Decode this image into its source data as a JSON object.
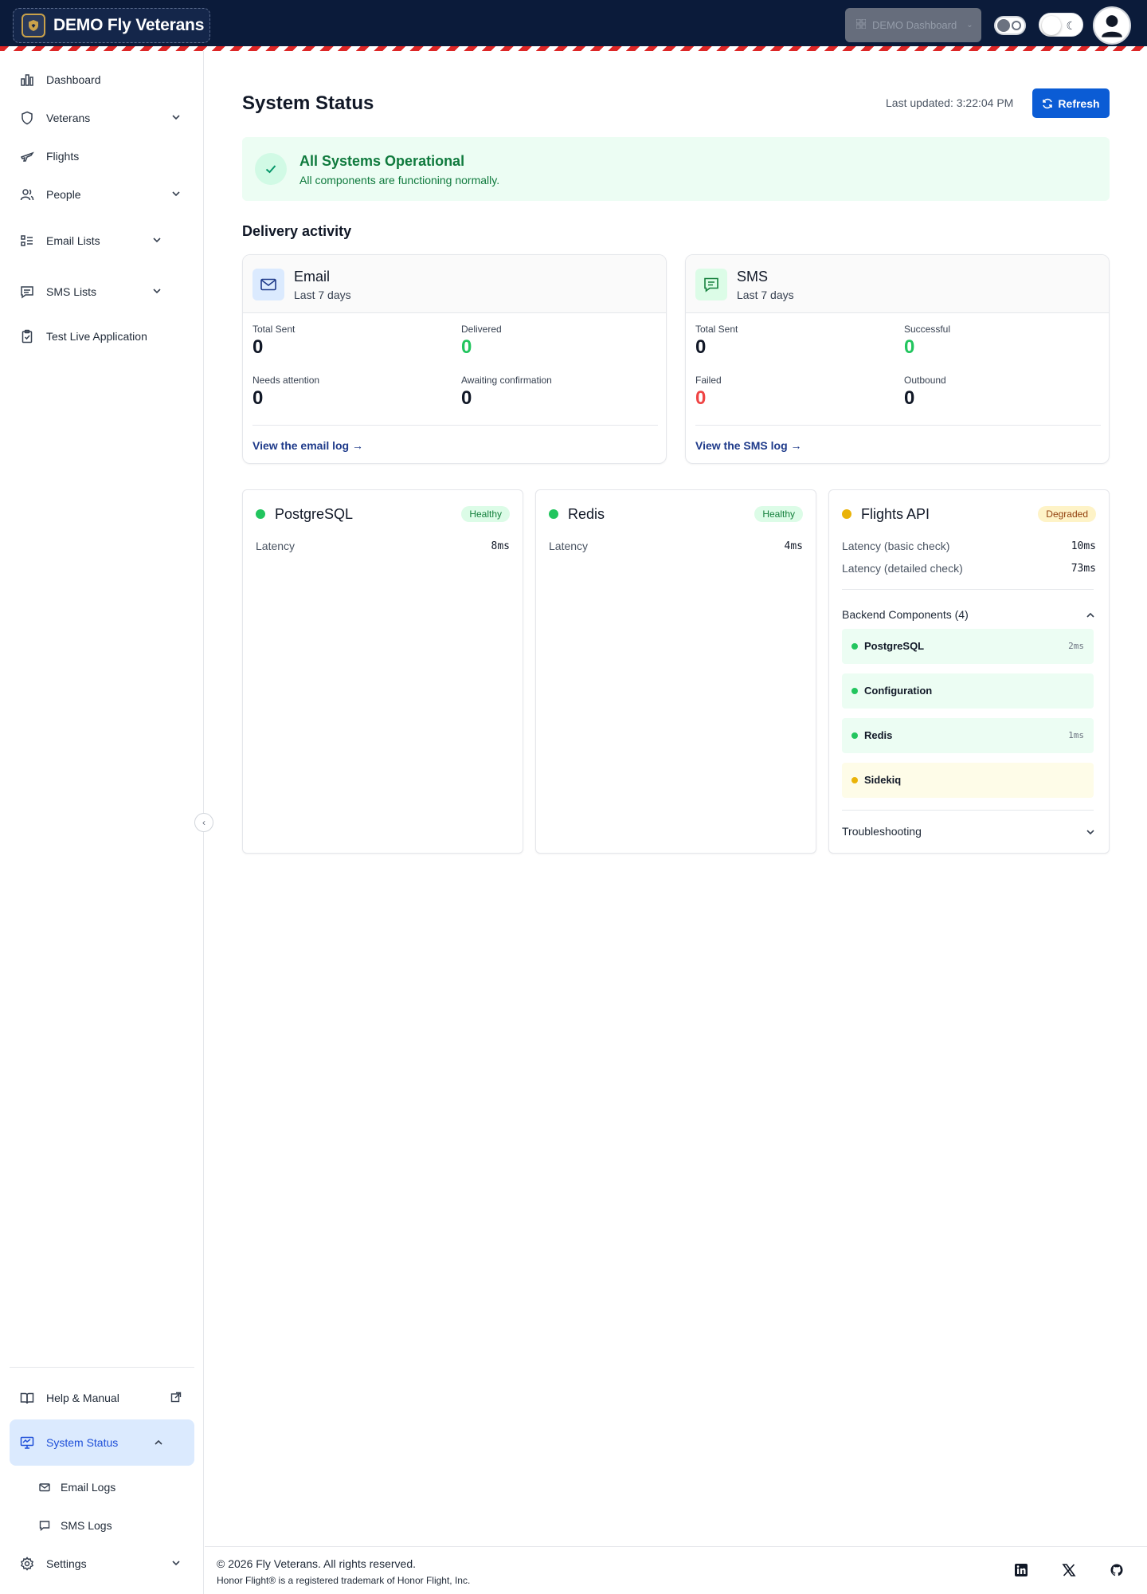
{
  "header": {
    "brand_name": "DEMO Fly Veterans",
    "demo_dashboard_label": "DEMO Dashboard",
    "icons": [
      "shield-logo-icon",
      "grid-icon",
      "chevron-down-icon",
      "toggle-icon",
      "moon-icon",
      "user-avatar-icon"
    ]
  },
  "sidebar": {
    "items": [
      {
        "label": "Dashboard",
        "icon": "bar-chart-icon"
      },
      {
        "label": "Veterans",
        "icon": "shield-icon"
      },
      {
        "label": "Flights",
        "icon": "plane-icon"
      },
      {
        "label": "People",
        "icon": "users-icon"
      },
      {
        "label": "Email Lists",
        "icon": "list-icon"
      },
      {
        "label": "SMS Lists",
        "icon": "message-icon"
      },
      {
        "label": "Test Live Application",
        "icon": "clipboard-icon"
      }
    ],
    "bottom_items": [
      {
        "label": "Help & Manual",
        "icon": "book-icon"
      },
      {
        "label": "System Status",
        "icon": "monitor-icon"
      },
      {
        "label": "Email Logs",
        "icon": "mail-icon"
      },
      {
        "label": "SMS Logs",
        "icon": "message-icon"
      },
      {
        "label": "Settings",
        "icon": "gear-icon"
      }
    ]
  },
  "page": {
    "title": "System Status",
    "last_updated": "Last updated: 3:22:04 PM",
    "refresh_label": "Refresh"
  },
  "banner": {
    "title": "All Systems Operational",
    "subtitle": "All components are functioning normally."
  },
  "delivery": {
    "section_title": "Delivery activity",
    "email": {
      "title": "Email",
      "period": "Last 7 days",
      "stats": [
        {
          "label": "Total Sent",
          "value": "0"
        },
        {
          "label": "Delivered",
          "value": "0"
        },
        {
          "label": "Needs attention",
          "value": "0"
        },
        {
          "label": "Awaiting confirmation",
          "value": "0"
        }
      ],
      "link": "View the email log →"
    },
    "sms": {
      "title": "SMS",
      "period": "Last 7 days",
      "stats": [
        {
          "label": "Total Sent",
          "value": "0"
        },
        {
          "label": "Successful",
          "value": "0"
        },
        {
          "label": "Failed",
          "value": "0"
        },
        {
          "label": "Outbound",
          "value": "0"
        }
      ],
      "link": "View the SMS log →"
    }
  },
  "services": {
    "postgres": {
      "name": "PostgreSQL",
      "status": "Healthy",
      "latency_label": "Latency",
      "latency": "8ms"
    },
    "redis": {
      "name": "Redis",
      "status": "Healthy",
      "latency_label": "Latency",
      "latency": "4ms"
    },
    "flights_api": {
      "name": "Flights API",
      "status": "Degraded",
      "basic_label": "Latency (basic check)",
      "basic_value": "10ms",
      "detailed_label": "Latency (detailed check)",
      "detailed_value": "73ms",
      "backend_header": "Backend Components (4)",
      "components": [
        {
          "name": "PostgreSQL",
          "latency": "2ms",
          "status": "ok"
        },
        {
          "name": "Configuration",
          "latency": "",
          "status": "ok"
        },
        {
          "name": "Redis",
          "latency": "1ms",
          "status": "ok"
        },
        {
          "name": "Sidekiq",
          "latency": "",
          "status": "warn"
        }
      ],
      "troubleshooting_label": "Troubleshooting"
    }
  },
  "colors": {
    "healthy": "#22c55e",
    "degraded": "#eab308",
    "failed": "#ef4444",
    "primary": "#0b5cd5",
    "navbar": "#0b1b3a"
  },
  "footer": {
    "copyright": "© 2026 Fly Veterans. All rights reserved.",
    "trademark": "Honor Flight® is a registered trademark of Honor Flight, Inc.",
    "social_icons": [
      "linkedin-icon",
      "x-icon",
      "github-icon"
    ]
  }
}
